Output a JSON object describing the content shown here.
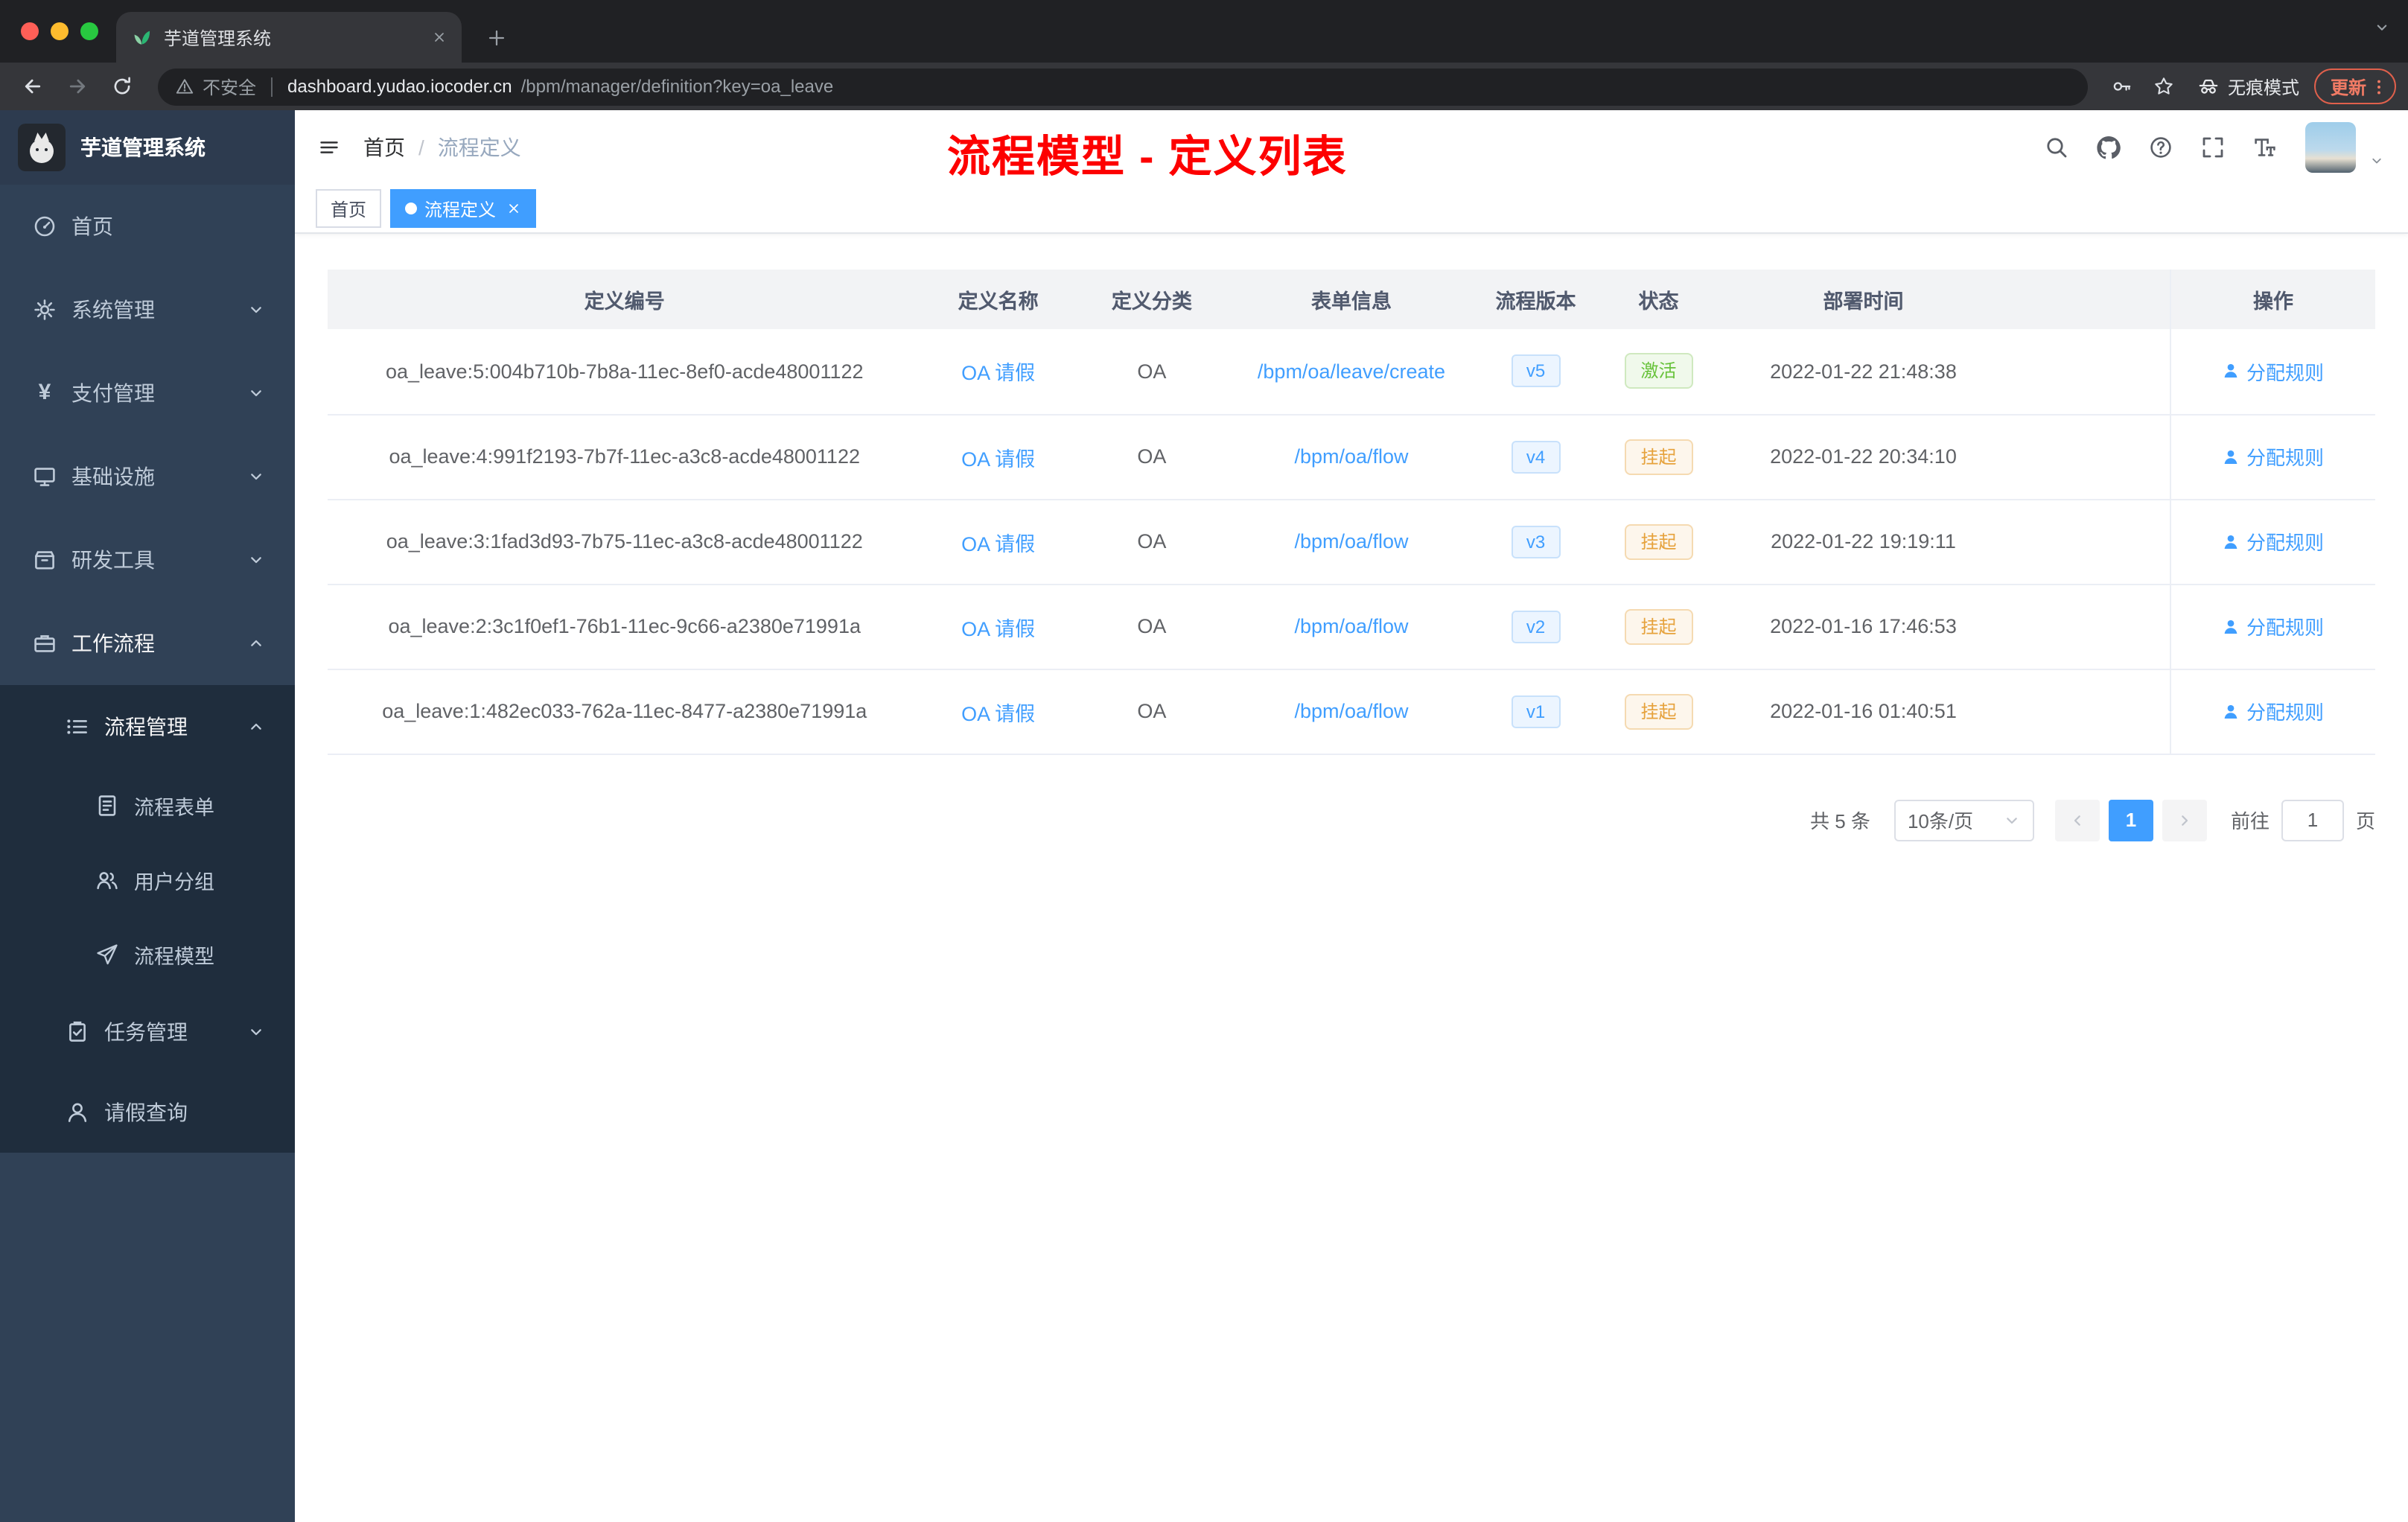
{
  "colors": {
    "accent": "#409eff",
    "success": "#67c23a",
    "warning": "#e6a23c",
    "annotation_red": "#fd0000",
    "sidebar_bg": "#304156",
    "submenu_bg": "#1f2d3d"
  },
  "browser": {
    "tab_title": "芋道管理系统",
    "security_label": "不安全",
    "url_host": "dashboard.yudao.iocoder.cn",
    "url_path": "/bpm/manager/definition?key=oa_leave",
    "incognito_label": "无痕模式",
    "update_label": "更新"
  },
  "sidebar": {
    "logo_title": "芋道管理系统",
    "items": [
      {
        "label": "首页"
      },
      {
        "label": "系统管理"
      },
      {
        "label": "支付管理"
      },
      {
        "label": "基础设施"
      },
      {
        "label": "研发工具"
      },
      {
        "label": "工作流程"
      },
      {
        "label": "流程管理"
      },
      {
        "label": "流程表单"
      },
      {
        "label": "用户分组"
      },
      {
        "label": "流程模型"
      },
      {
        "label": "任务管理"
      },
      {
        "label": "请假查询"
      }
    ]
  },
  "header": {
    "breadcrumb_home": "首页",
    "breadcrumb_separator": "/",
    "breadcrumb_current": "流程定义",
    "annotation": "流程模型 - 定义列表"
  },
  "tags": {
    "home": "首页",
    "active": "流程定义"
  },
  "table": {
    "columns": [
      "定义编号",
      "定义名称",
      "定义分类",
      "表单信息",
      "流程版本",
      "状态",
      "部署时间",
      "操作"
    ],
    "rows": [
      {
        "id": "oa_leave:5:004b710b-7b8a-11ec-8ef0-acde48001122",
        "name": "OA 请假",
        "category": "OA",
        "form": "/bpm/oa/leave/create",
        "version": "v5",
        "status": "激活",
        "time": "2022-01-22 21:48:38",
        "action": "分配规则"
      },
      {
        "id": "oa_leave:4:991f2193-7b7f-11ec-a3c8-acde48001122",
        "name": "OA 请假",
        "category": "OA",
        "form": "/bpm/oa/flow",
        "version": "v4",
        "status": "挂起",
        "time": "2022-01-22 20:34:10",
        "action": "分配规则"
      },
      {
        "id": "oa_leave:3:1fad3d93-7b75-11ec-a3c8-acde48001122",
        "name": "OA 请假",
        "category": "OA",
        "form": "/bpm/oa/flow",
        "version": "v3",
        "status": "挂起",
        "time": "2022-01-22 19:19:11",
        "action": "分配规则"
      },
      {
        "id": "oa_leave:2:3c1f0ef1-76b1-11ec-9c66-a2380e71991a",
        "name": "OA 请假",
        "category": "OA",
        "form": "/bpm/oa/flow",
        "version": "v2",
        "status": "挂起",
        "time": "2022-01-16 17:46:53",
        "action": "分配规则"
      },
      {
        "id": "oa_leave:1:482ec033-762a-11ec-8477-a2380e71991a",
        "name": "OA 请假",
        "category": "OA",
        "form": "/bpm/oa/flow",
        "version": "v1",
        "status": "挂起",
        "time": "2022-01-16 01:40:51",
        "action": "分配规则"
      }
    ]
  },
  "pagination": {
    "total": "共 5 条",
    "page_size": "10条/页",
    "page": "1",
    "goto": "前往",
    "goto_value": "1",
    "unit": "页"
  }
}
